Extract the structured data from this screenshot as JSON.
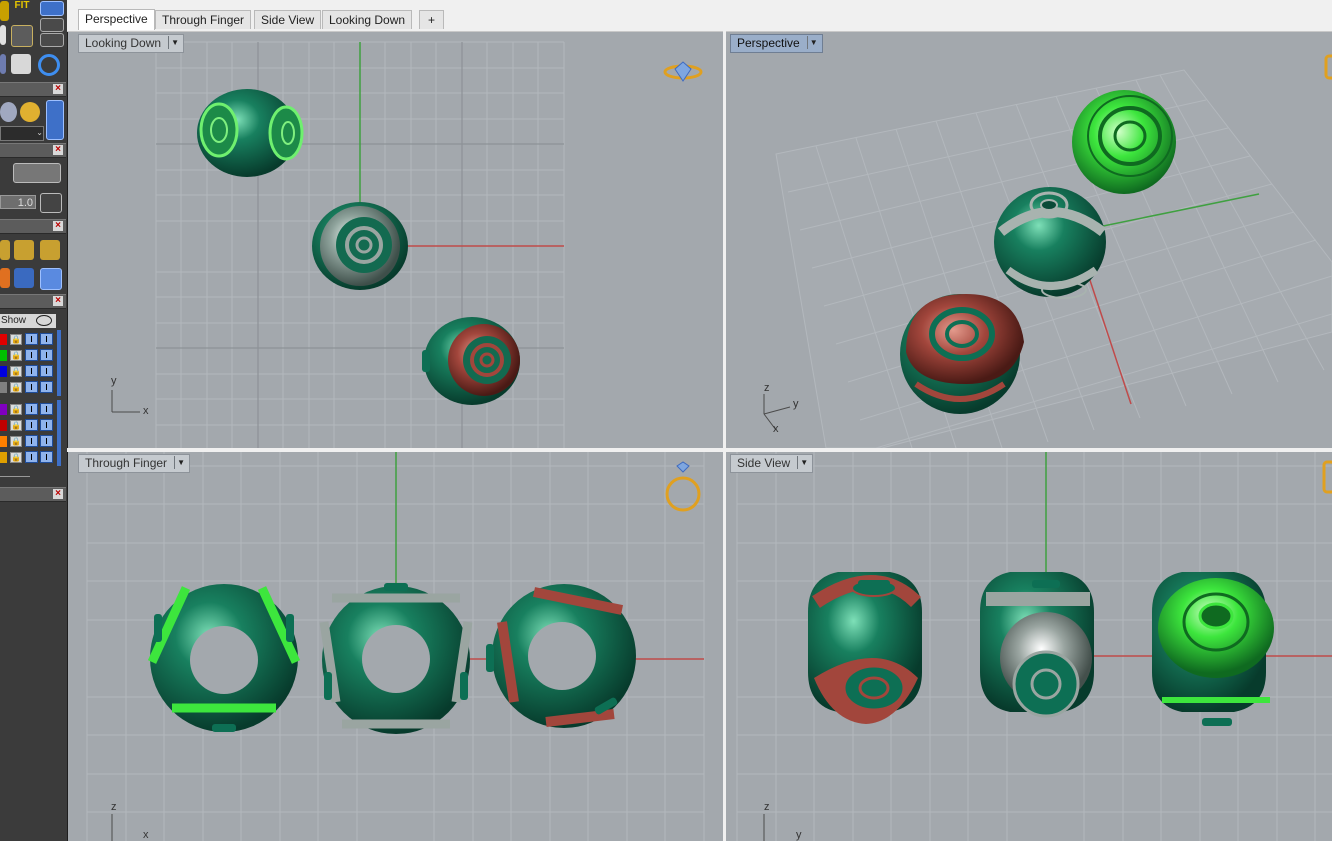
{
  "tabs": [
    {
      "label": "Perspective",
      "active": true
    },
    {
      "label": "Through Finger",
      "active": false
    },
    {
      "label": "Side View",
      "active": false
    },
    {
      "label": "Looking Down",
      "active": false
    }
  ],
  "add_tab_symbol": "+",
  "viewports": {
    "looking_down": {
      "label": "Looking Down",
      "axis_y": "y",
      "axis_x": "x"
    },
    "perspective": {
      "label": "Perspective",
      "axis_z": "z",
      "axis_y": "y",
      "axis_x": "x"
    },
    "through_finger": {
      "label": "Through Finger",
      "axis_z": "z",
      "axis_x": "x"
    },
    "side_view": {
      "label": "Side View",
      "axis_z": "z",
      "axis_y": "y"
    }
  },
  "left_panel": {
    "fit_label": "FIT",
    "spin_value": "1.0",
    "show_label": "Show",
    "layer_colors": [
      "#e00000",
      "#00c000",
      "#0000e0",
      "#808080",
      "#8000c0",
      "#c00000",
      "#ff8000",
      "#e0a000"
    ]
  },
  "colors": {
    "bead_green": "#0d6f54",
    "bright_green": "#3de63d",
    "red_band": "#a2463c",
    "silver_band": "#8f9a96",
    "grid_line": "#b3b8bd",
    "axis_red": "#c04a4a",
    "axis_green": "#3fa040",
    "viewport_bg": "#a3a8ad"
  }
}
